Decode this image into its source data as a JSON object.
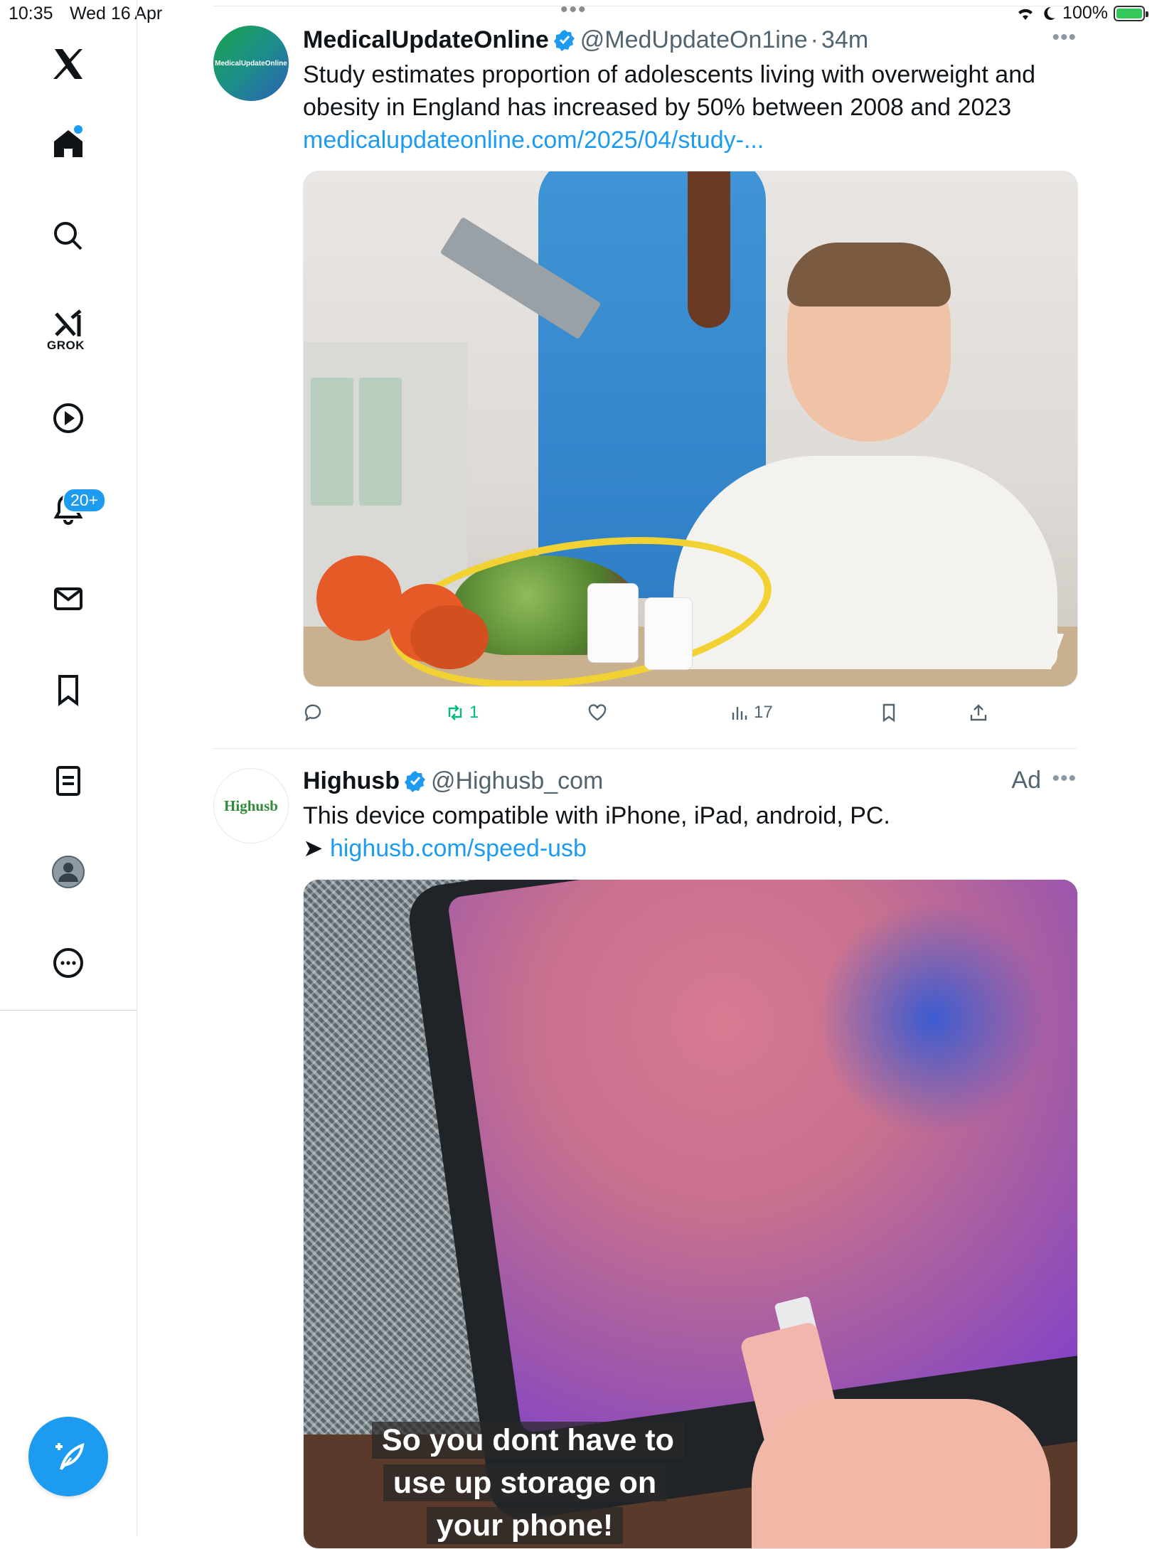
{
  "status_bar": {
    "time": "10:35",
    "date": "Wed 16 Apr",
    "battery": "100%"
  },
  "sidebar": {
    "items": [
      {
        "name": "x-logo-icon"
      },
      {
        "name": "home-icon"
      },
      {
        "name": "search-icon"
      },
      {
        "name": "grok-icon",
        "label": "GROK"
      },
      {
        "name": "video-icon"
      },
      {
        "name": "notifications-icon",
        "badge": "20+"
      },
      {
        "name": "messages-icon"
      },
      {
        "name": "bookmarks-icon"
      },
      {
        "name": "lists-icon"
      },
      {
        "name": "profile-icon"
      },
      {
        "name": "more-icon"
      }
    ],
    "compose": {
      "icon": "feather-plus-icon"
    }
  },
  "tweets": [
    {
      "name": "MedicalUpdateOnline",
      "handle": "@MedUpdateOn1ine",
      "separator": "·",
      "time": "34m",
      "avatar_text": "MedicalUpdateOnline",
      "text": "Study estimates proportion of adolescents living with overweight and obesity in England has increased by 50% between 2008 and 2023",
      "link": "medicalupdateonline.com/2025/04/study-...",
      "actions": {
        "reposts": "1",
        "views": "17"
      }
    },
    {
      "name": "Highusb",
      "handle": "@Highusb_com",
      "ad_label": "Ad",
      "avatar_text": "Highusb",
      "text": "This device compatible with iPhone, iPad, android, PC.",
      "arrow": "➤",
      "link": "highusb.com/speed-usb",
      "video_caption": "So you dont have to use up storage on your phone!"
    }
  ],
  "colors": {
    "accent": "#1d9bf0",
    "repost": "#00ba7c",
    "secondary_text": "#536471"
  }
}
